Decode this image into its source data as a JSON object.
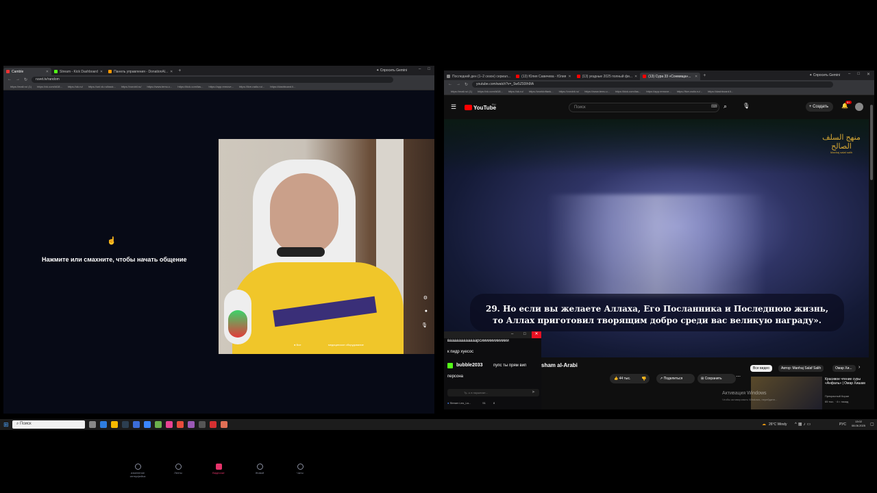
{
  "left_window": {
    "tabs": [
      "Camble",
      "Stream - Kick Dashboard",
      "Панель управления - DonationAl..."
    ],
    "gemini_button": "Спросить Gemini",
    "url": "ruvet.tv/random",
    "bookmarks": [
      "https://mail.ru/ (1)",
      "https://vk.com/id18...",
      "https://ok.ru/",
      "https://uni.vk.ru/back...",
      "https://vorobii.ru/",
      "https://www.temu.c...",
      "https://kick.com/las...",
      "https://app.remove...",
      "https://live-radio.ru/...",
      "https://dashboard.li..."
    ],
    "prompt_text": "Нажмите или смахните, чтобы начать общение",
    "video_labels": {
      "left": "● Все",
      "right": "медицинское оборудование"
    },
    "bottom_nav": [
      "изменение интерфейса",
      "Ленты",
      "Видеочат",
      "Живой",
      "Чаты"
    ]
  },
  "right_window": {
    "tabs": [
      "Последний ден (1–2 сезон) сериал...",
      "(13) Юлия Савичева - Юлия",
      "(13) уездные 2025 полный фи...",
      "(13) Сура 33 «Сонмища»..."
    ],
    "gemini_button": "Спросить Gemini",
    "url": "youtube.com/watch?v=_Sw5Z93Ih9IA",
    "bookmarks": [
      "https://mail.ru/ (1)",
      "https://vk.com/id18...",
      "https://ok.ru/",
      "https://worldoftank...",
      "https://vorobii.ru/",
      "https://www.temu.c...",
      "https://kick.com/las...",
      "https://app.remove...",
      "https://live-radio.ru/...",
      "https://dashboard.li..."
    ],
    "youtube": {
      "logo": "YouTube",
      "region": "RU",
      "search_placeholder": "Поиск",
      "create_label": "Создать",
      "notif_count": "9+",
      "channel_logo_ar": "منهج السلف الصالح",
      "channel_logo_sub": "Manhaj salaf salih",
      "subtitle_line1": "29. Но если вы желаете Аллаха, Его Посланника и Последнюю жизнь,",
      "subtitle_line2": "то Аллах приготовил творящим добро среди вас великую награду».",
      "channel_name_partial": "sham al-Arabi",
      "likes": "44 тыс.",
      "share": "Поделиться",
      "save": "Сохранить",
      "chips": [
        "Все видео",
        "Автор: Manhaj Salaf Salih",
        "Омар Хи..."
      ],
      "rec_title": "Красивое чтение суры «Анфаль» | Омар Хишам",
      "rec_channel": "Прекрасный Коран",
      "rec_meta": "65 тыс. · 4 г. назад",
      "activation_line1": "Активация Windows",
      "activation_line2": "Чтобы активировать Windows, перейдите..."
    }
  },
  "chat_overlay": {
    "msg1": "ваааааааааааарсииииииииииии",
    "msg2": "к пидр хуесос",
    "user": "bubble2033",
    "msg3": "пупс ты прям вип",
    "msg4": "персона",
    "input_placeholder": "Ту...ь в наушнике...",
    "footer_name": "Stream Leo_La...",
    "footer_count1": "51",
    "footer_count2": "8"
  },
  "taskbar": {
    "search": "Поиск",
    "weather": "26°C  Windy",
    "lang": "РУС",
    "time": "13:02",
    "date": "08.06.2025"
  },
  "colors": {
    "youtube_red": "#ff0000",
    "kick_green": "#53fc18",
    "chat_close": "#e81123",
    "taskbar_bg": "#1c1c1c"
  }
}
